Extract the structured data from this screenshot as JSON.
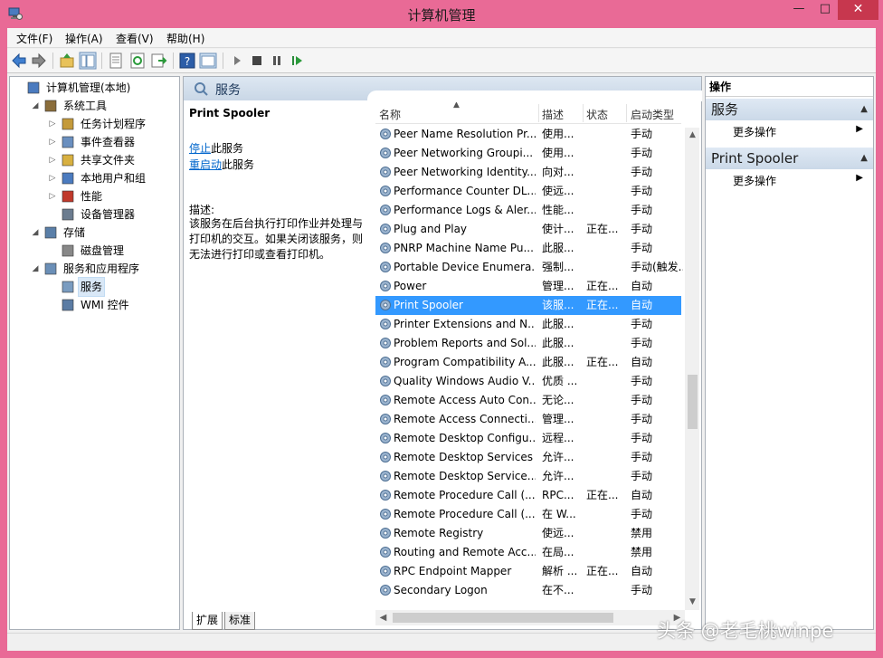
{
  "window": {
    "title": "计算机管理",
    "min": "—",
    "max": "□",
    "close": "✕"
  },
  "menu": [
    {
      "label": "文件(F)"
    },
    {
      "label": "操作(A)"
    },
    {
      "label": "查看(V)"
    },
    {
      "label": "帮助(H)"
    }
  ],
  "toolbar": {
    "icons": [
      "back-icon",
      "forward-icon",
      "up-icon",
      "show-hide-tree-icon",
      "properties-icon",
      "refresh-icon",
      "export-icon",
      "help-icon",
      "console-icon",
      "play-icon",
      "stop-icon",
      "pause-icon",
      "restart-icon"
    ]
  },
  "tree": {
    "items": [
      {
        "label": "计算机管理(本地)",
        "icon": "computer-management-icon"
      },
      {
        "label": "系统工具",
        "icon": "system-tools-icon"
      },
      {
        "label": "任务计划程序",
        "icon": "task-scheduler-icon"
      },
      {
        "label": "事件查看器",
        "icon": "event-viewer-icon"
      },
      {
        "label": "共享文件夹",
        "icon": "shared-folders-icon"
      },
      {
        "label": "本地用户和组",
        "icon": "local-users-icon"
      },
      {
        "label": "性能",
        "icon": "performance-icon"
      },
      {
        "label": "设备管理器",
        "icon": "device-manager-icon"
      },
      {
        "label": "存储",
        "icon": "storage-icon"
      },
      {
        "label": "磁盘管理",
        "icon": "disk-management-icon"
      },
      {
        "label": "服务和应用程序",
        "icon": "services-apps-icon"
      },
      {
        "label": "服务",
        "icon": "services-icon"
      },
      {
        "label": "WMI 控件",
        "icon": "wmi-icon"
      }
    ]
  },
  "center": {
    "header": "服务",
    "selected_service": "Print Spooler",
    "stop_link": "停止",
    "stop_suffix": "此服务",
    "restart_link": "重启动",
    "restart_suffix": "此服务",
    "desc_label": "描述:",
    "desc_text": "该服务在后台执行打印作业并处理与打印机的交互。如果关闭该服务，则无法进行打印或查看打印机。",
    "columns": {
      "name": "名称",
      "desc": "描述",
      "status": "状态",
      "start": "启动类型"
    },
    "rows": [
      {
        "name": "Peer Name Resolution Pr...",
        "desc": "使用...",
        "status": "",
        "start": "手动"
      },
      {
        "name": "Peer Networking Groupi...",
        "desc": "使用...",
        "status": "",
        "start": "手动"
      },
      {
        "name": "Peer Networking Identity...",
        "desc": "向对...",
        "status": "",
        "start": "手动"
      },
      {
        "name": "Performance Counter DL...",
        "desc": "使远...",
        "status": "",
        "start": "手动"
      },
      {
        "name": "Performance Logs & Aler...",
        "desc": "性能...",
        "status": "",
        "start": "手动"
      },
      {
        "name": "Plug and Play",
        "desc": "使计...",
        "status": "正在...",
        "start": "手动"
      },
      {
        "name": "PNRP Machine Name Pu...",
        "desc": "此服...",
        "status": "",
        "start": "手动"
      },
      {
        "name": "Portable Device Enumera...",
        "desc": "强制...",
        "status": "",
        "start": "手动(触发..."
      },
      {
        "name": "Power",
        "desc": "管理...",
        "status": "正在...",
        "start": "自动"
      },
      {
        "name": "Print Spooler",
        "desc": "该服...",
        "status": "正在...",
        "start": "自动"
      },
      {
        "name": "Printer Extensions and N...",
        "desc": "此服...",
        "status": "",
        "start": "手动"
      },
      {
        "name": "Problem Reports and Sol...",
        "desc": "此服...",
        "status": "",
        "start": "手动"
      },
      {
        "name": "Program Compatibility A...",
        "desc": "此服...",
        "status": "正在...",
        "start": "自动"
      },
      {
        "name": "Quality Windows Audio V...",
        "desc": "优质 ...",
        "status": "",
        "start": "手动"
      },
      {
        "name": "Remote Access Auto Con...",
        "desc": "无论...",
        "status": "",
        "start": "手动"
      },
      {
        "name": "Remote Access Connecti...",
        "desc": "管理...",
        "status": "",
        "start": "手动"
      },
      {
        "name": "Remote Desktop Configu...",
        "desc": "远程...",
        "status": "",
        "start": "手动"
      },
      {
        "name": "Remote Desktop Services",
        "desc": "允许...",
        "status": "",
        "start": "手动"
      },
      {
        "name": "Remote Desktop Service...",
        "desc": "允许...",
        "status": "",
        "start": "手动"
      },
      {
        "name": "Remote Procedure Call (...",
        "desc": "RPC...",
        "status": "正在...",
        "start": "自动"
      },
      {
        "name": "Remote Procedure Call (...",
        "desc": "在 W...",
        "status": "",
        "start": "手动"
      },
      {
        "name": "Remote Registry",
        "desc": "使远...",
        "status": "",
        "start": "禁用"
      },
      {
        "name": "Routing and Remote Acc...",
        "desc": "在局...",
        "status": "",
        "start": "禁用"
      },
      {
        "name": "RPC Endpoint Mapper",
        "desc": "解析 ...",
        "status": "正在...",
        "start": "自动"
      },
      {
        "name": "Secondary Logon",
        "desc": "在不...",
        "status": "",
        "start": "手动"
      }
    ],
    "tabs": [
      {
        "label": "扩展"
      },
      {
        "label": "标准"
      }
    ]
  },
  "actions": {
    "title": "操作",
    "sections": [
      {
        "label": "服务",
        "item": "更多操作"
      },
      {
        "label": "Print Spooler",
        "item": "更多操作"
      }
    ]
  },
  "watermark": "头条 @老毛桃winpe",
  "colors": {
    "titlebar": "#e96a96",
    "selection": "#3399ff",
    "close": "#c7374e"
  }
}
